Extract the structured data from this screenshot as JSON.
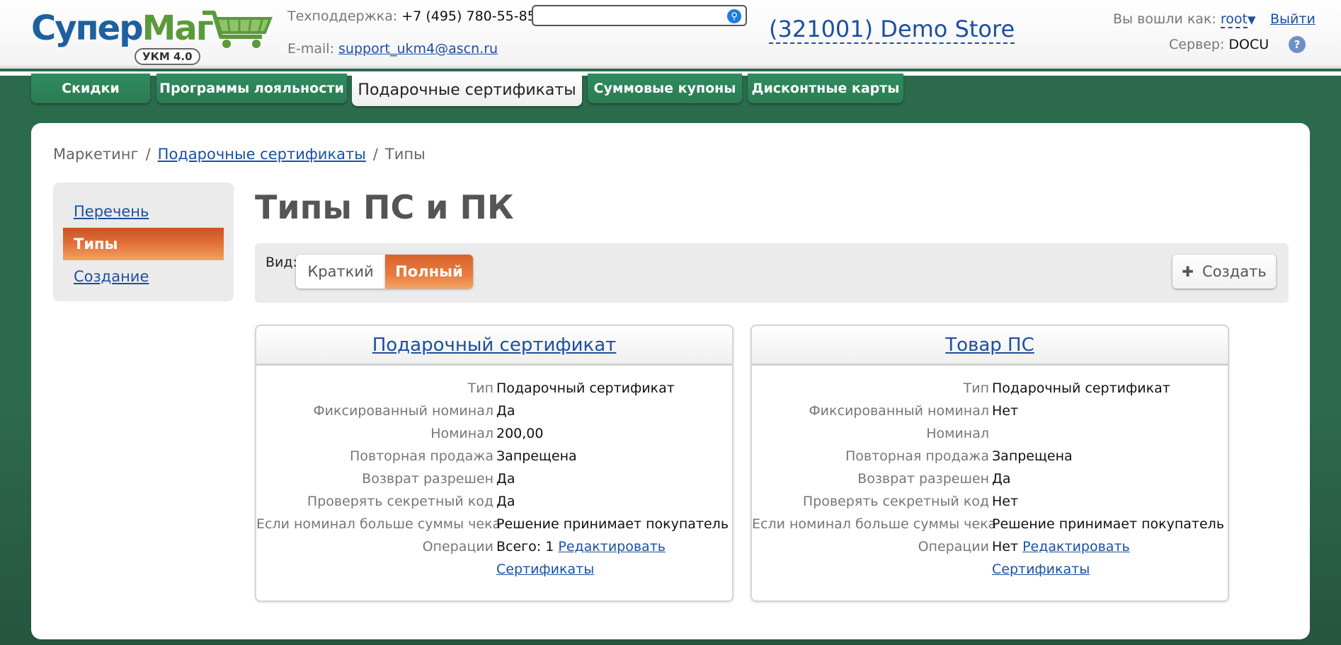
{
  "header": {
    "logo": {
      "part1": "Супер",
      "part2": "Маг",
      "badge": "УКМ 4.0"
    },
    "support_label": "Техподдержка:",
    "support_phone": "+7 (495) 780-55-85",
    "email_label": "E-mail:",
    "email": "support_ukm4@ascn.ru",
    "search": {
      "value": "",
      "placeholder": ""
    },
    "store": "(321001) Demo Store",
    "logged_label": "Вы вошли как:",
    "user": "root",
    "logout": "Выйти",
    "server_label": "Сервер:",
    "server": "DOCU",
    "help": "?"
  },
  "tabs": [
    {
      "label": "Скидки",
      "active": false
    },
    {
      "label": "Программы лояльности",
      "active": false
    },
    {
      "label": "Подарочные сертификаты",
      "active": true
    },
    {
      "label": "Суммовые купоны",
      "active": false
    },
    {
      "label": "Дисконтные карты",
      "active": false
    }
  ],
  "breadcrumb": {
    "root": "Маркетинг",
    "sep": "/",
    "link": "Подарочные сертификаты",
    "current": "Типы"
  },
  "sidebar": {
    "items": [
      {
        "label": "Перечень",
        "active": false
      },
      {
        "label": "Типы",
        "active": true
      },
      {
        "label": "Создание",
        "active": false
      }
    ]
  },
  "page": {
    "title": "Типы ПС и ПК",
    "view_label": "Вид:",
    "view_brief": "Краткий",
    "view_full": "Полный",
    "view_selected": "Полный",
    "create": "Создать"
  },
  "cards": [
    {
      "title": "Подарочный сертификат",
      "rows": [
        {
          "k": "Тип",
          "v": "Подарочный сертификат"
        },
        {
          "k": "Фиксированный номинал",
          "v": "Да"
        },
        {
          "k": "Номинал",
          "v": "200,00"
        },
        {
          "k": "Повторная продажа",
          "v": "Запрещена"
        },
        {
          "k": "Возврат разрешен",
          "v": "Да"
        },
        {
          "k": "Проверять секретный код",
          "v": "Да"
        },
        {
          "k": "Если номинал больше суммы чека",
          "v": "Решение принимает покупатель"
        }
      ],
      "ops_label": "Операции",
      "ops_value": "Всего: 1",
      "edit": "Редактировать",
      "certs": "Сертификаты"
    },
    {
      "title": "Товар ПС",
      "rows": [
        {
          "k": "Тип",
          "v": "Подарочный сертификат"
        },
        {
          "k": "Фиксированный номинал",
          "v": "Нет"
        },
        {
          "k": "Номинал",
          "v": ""
        },
        {
          "k": "Повторная продажа",
          "v": "Запрещена"
        },
        {
          "k": "Возврат разрешен",
          "v": "Да"
        },
        {
          "k": "Проверять секретный код",
          "v": "Нет"
        },
        {
          "k": "Если номинал больше суммы чека",
          "v": "Решение принимает покупатель"
        }
      ],
      "ops_label": "Операции",
      "ops_value": "Нет",
      "edit": "Редактировать",
      "certs": "Сертификаты"
    }
  ],
  "colors": {
    "background": "#2c6a4d",
    "tab_green": "#2f8d5f",
    "accent_orange": "#e06d35",
    "link": "#1d4f9e"
  }
}
